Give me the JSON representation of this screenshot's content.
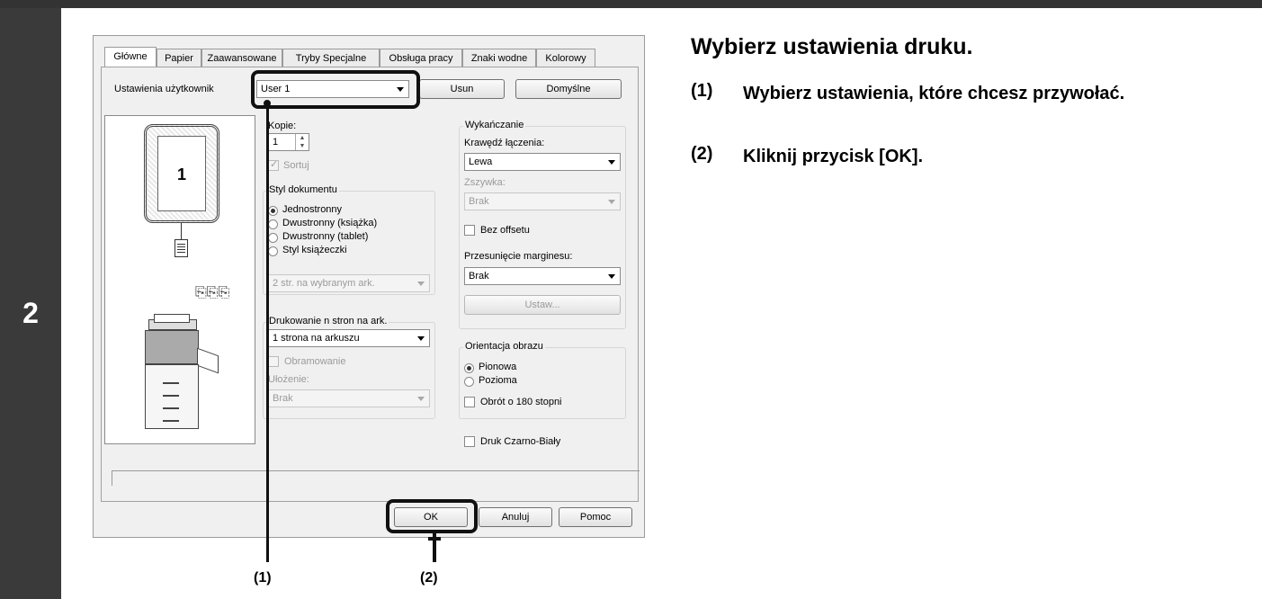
{
  "step": "2",
  "tabs": [
    "Główne",
    "Papier",
    "Zaawansowane",
    "Tryby Specjalne",
    "Obsługa pracy",
    "Znaki wodne",
    "Kolorowy"
  ],
  "user_settings": {
    "label": "Ustawienia użytkownik",
    "value": "User 1",
    "delete": "Usun",
    "defaults": "Domyślne"
  },
  "preview": {
    "page_number": "1"
  },
  "copies": {
    "label": "Kopie:",
    "value": "1",
    "collate": "Sortuj"
  },
  "doc_style": {
    "legend": "Styl dokumentu",
    "options": [
      "Jednostronny",
      "Dwustronny (książka)",
      "Dwustronny (tablet)",
      "Styl książeczki"
    ],
    "booklet_select": "2 str. na wybranym ark."
  },
  "n_up": {
    "legend": "Drukowanie n stron na ark.",
    "value": "1 strona na arkuszu",
    "border": "Obramowanie",
    "order_label": "Ułożenie:",
    "order_value": "Brak"
  },
  "finishing": {
    "legend": "Wykańczanie",
    "binding_label": "Krawędź łączenia:",
    "binding_value": "Lewa",
    "staple_label": "Zszywka:",
    "staple_value": "Brak",
    "no_offset": "Bez offsetu",
    "margin_label": "Przesunięcie marginesu:",
    "margin_value": "Brak",
    "set_button": "Ustaw..."
  },
  "orientation": {
    "legend": "Orientacja obrazu",
    "options": [
      "Pionowa",
      "Pozioma"
    ],
    "rotate": "Obrót o 180 stopni"
  },
  "bw_print": "Druk Czarno-Biały",
  "buttons": {
    "ok": "OK",
    "cancel": "Anuluj",
    "help": "Pomoc"
  },
  "callouts": [
    "(1)",
    "(2)"
  ],
  "instructions": {
    "heading": "Wybierz ustawienia druku.",
    "items": [
      {
        "num": "(1)",
        "text": "Wybierz ustawienia, które chcesz przywołać."
      },
      {
        "num": "(2)",
        "text": "Kliknij przycisk [OK]."
      }
    ]
  }
}
